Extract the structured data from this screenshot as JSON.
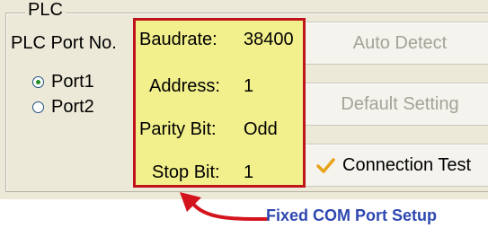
{
  "group": {
    "title": "PLC"
  },
  "port": {
    "label": "PLC Port No.",
    "options": [
      {
        "label": "Port1",
        "checked": true
      },
      {
        "label": "Port2",
        "checked": false
      }
    ]
  },
  "settings": {
    "baudrate_label": "Baudrate:",
    "baudrate_value": "38400",
    "address_label": "Address:",
    "address_value": "1",
    "parity_label": "Parity Bit:",
    "parity_value": "Odd",
    "stopbit_label": "Stop Bit:",
    "stopbit_value": "1"
  },
  "buttons": {
    "auto_detect": "Auto Detect",
    "default_setting": "Default Setting",
    "connection_test": "Connection Test"
  },
  "annotation": {
    "caption": "Fixed COM Port Setup"
  },
  "colors": {
    "highlight_fill": "#f2f08c",
    "highlight_border": "#c0141c",
    "caption": "#2f48b0",
    "arrow": "#d4141c",
    "check": "#e8a418"
  }
}
